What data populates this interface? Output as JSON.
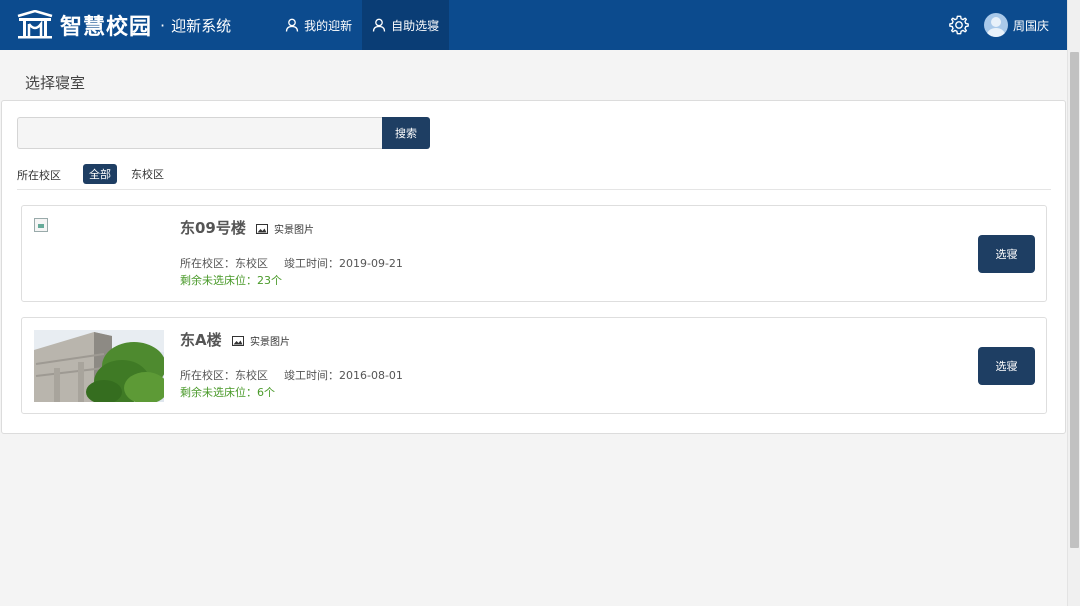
{
  "header": {
    "logo_title": "智慧校园",
    "logo_separator": "·",
    "logo_subtitle": "迎新系统",
    "brand_color": "#0c4b8e",
    "nav": [
      {
        "label": "我的迎新",
        "icon": "user-icon",
        "active": false
      },
      {
        "label": "自助选寝",
        "icon": "user-icon",
        "active": true
      }
    ],
    "settings_icon": "gear-icon",
    "user_name": "周国庆"
  },
  "page": {
    "title": "选择寝室"
  },
  "search": {
    "placeholder": "",
    "value": "",
    "button_label": "搜索"
  },
  "filter": {
    "label": "所在校区",
    "options": [
      {
        "label": "全部",
        "active": true
      },
      {
        "label": "东校区",
        "active": false
      }
    ]
  },
  "dorms": [
    {
      "name": "东09号楼",
      "photo_label": "实景图片",
      "campus_label": "所在校区：东校区",
      "completion_label": "竣工时间：2019-09-21",
      "beds_label": "剩余未选床位：23个",
      "has_image": false,
      "action_label": "选寝"
    },
    {
      "name": "东A楼",
      "photo_label": "实景图片",
      "campus_label": "所在校区：东校区",
      "completion_label": "竣工时间：2016-08-01",
      "beds_label": "剩余未选床位：6个",
      "has_image": true,
      "action_label": "选寝"
    }
  ],
  "colors": {
    "primary_button": "#1e3e63",
    "available_beds_text": "#4a9a2a"
  }
}
